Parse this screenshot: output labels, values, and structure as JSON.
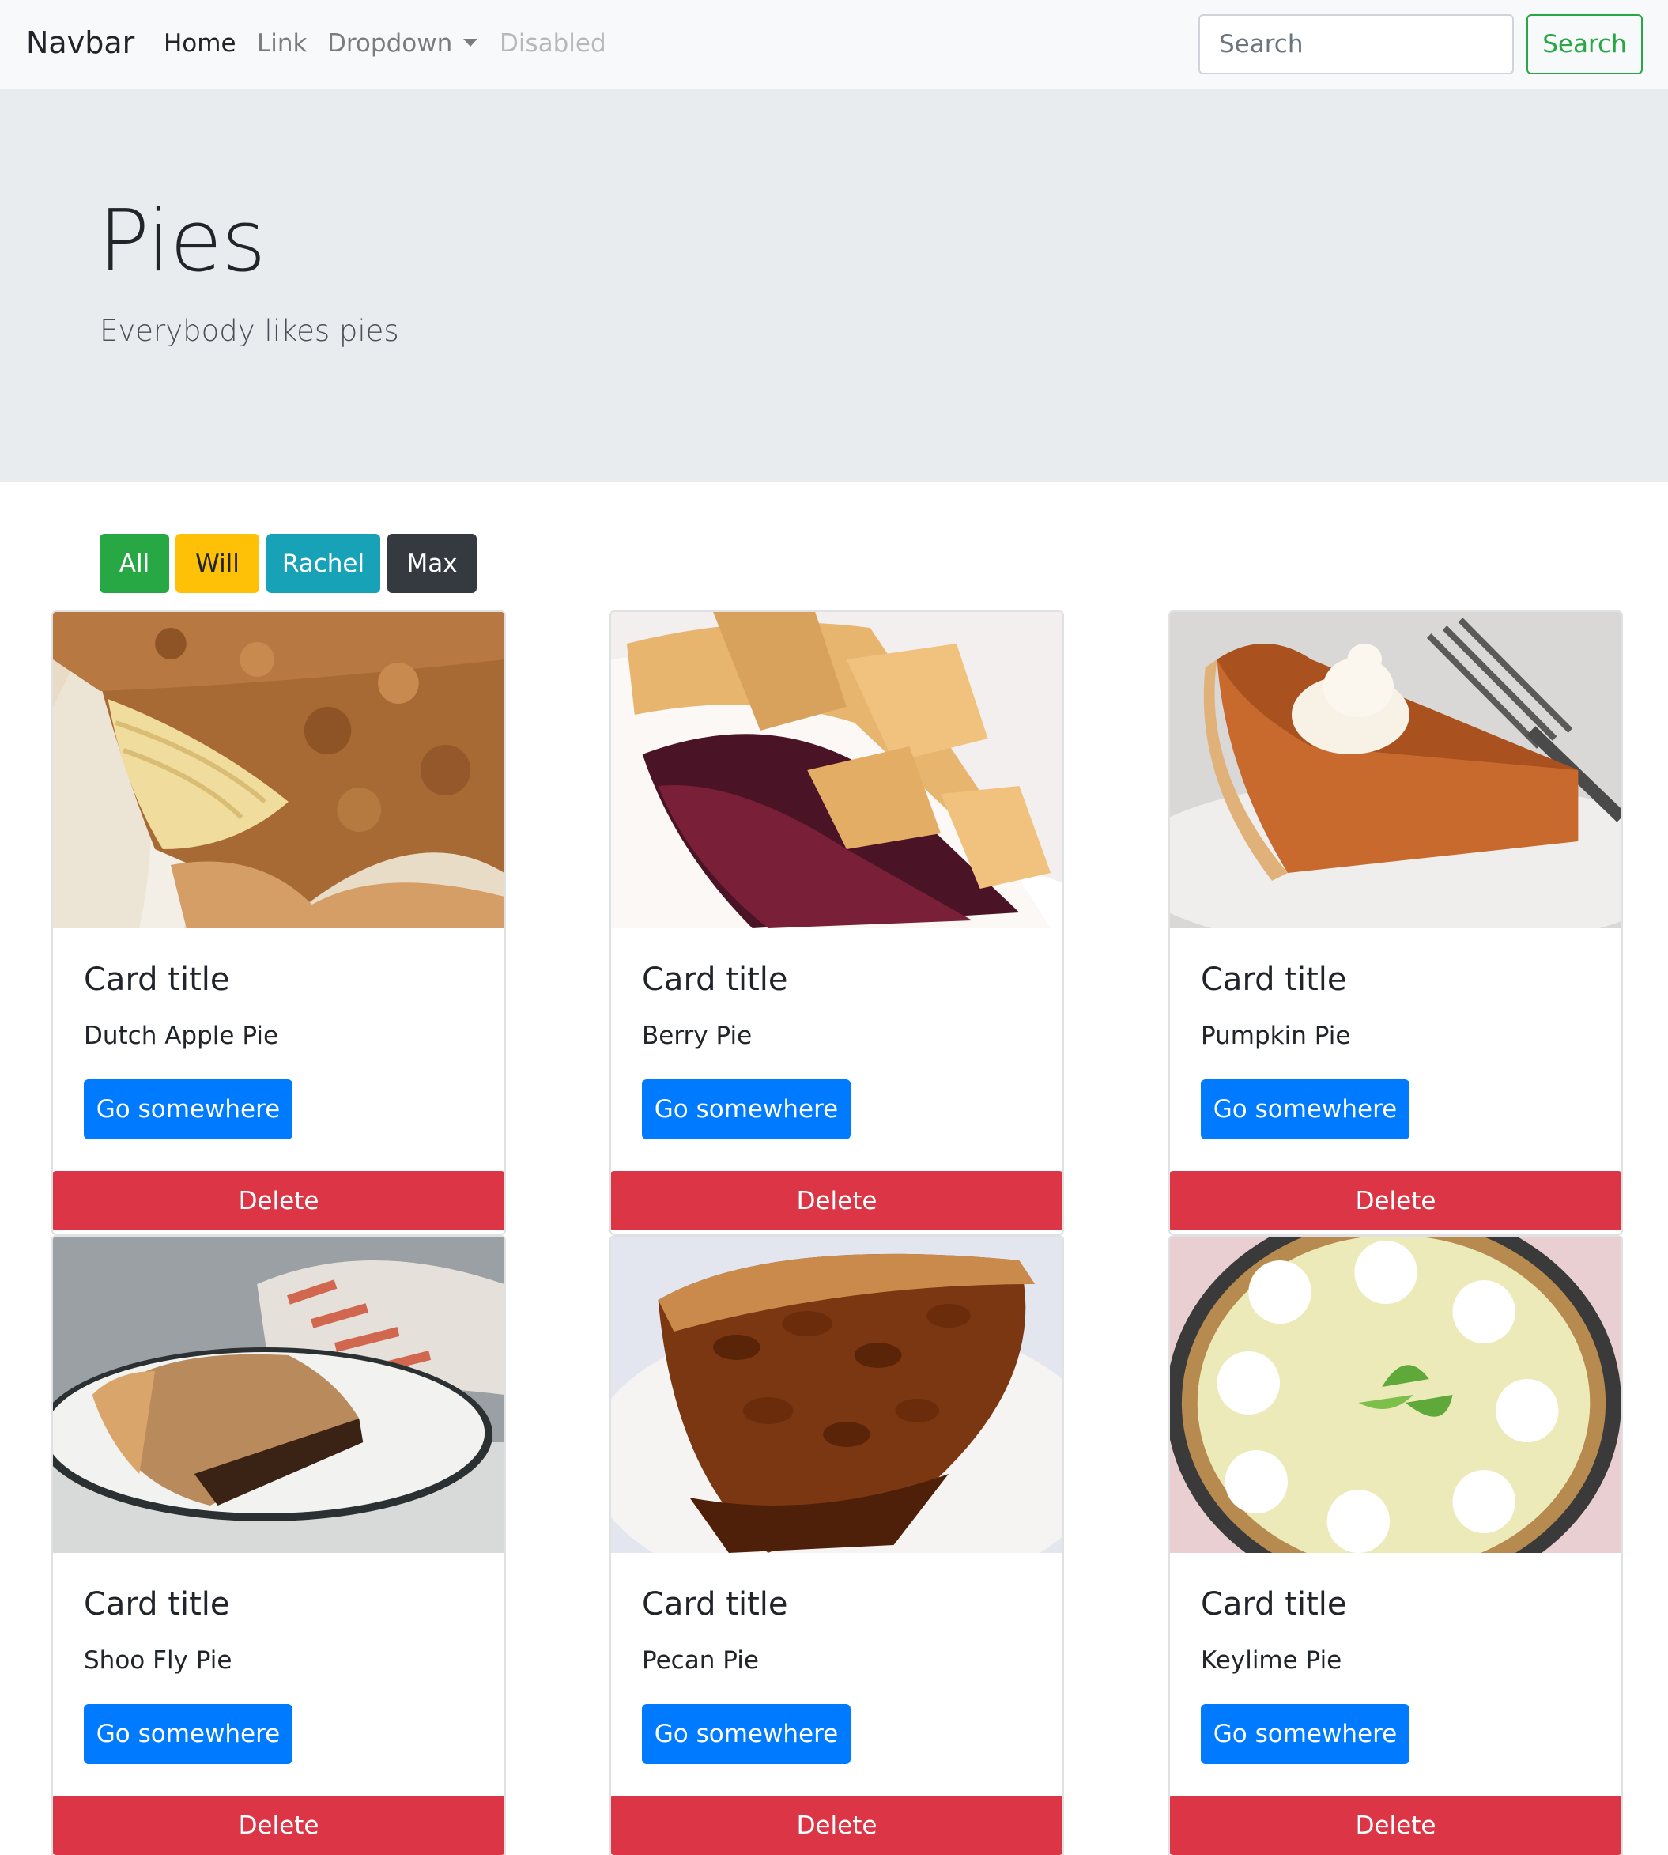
{
  "navbar": {
    "brand": "Navbar",
    "links": {
      "home": "Home",
      "link": "Link",
      "dropdown": "Dropdown",
      "disabled": "Disabled"
    },
    "search": {
      "placeholder": "Search",
      "button_label": "Search"
    }
  },
  "jumbotron": {
    "title": "Pies",
    "lead": "Everybody likes pies"
  },
  "filters": [
    {
      "label": "All",
      "color": "#28a745"
    },
    {
      "label": "Will",
      "color": "#ffc107"
    },
    {
      "label": "Rachel",
      "color": "#17a2b8"
    },
    {
      "label": "Max",
      "color": "#343a40"
    }
  ],
  "cards": [
    {
      "title": "Card title",
      "text": "Dutch Apple Pie",
      "button_label": "Go somewhere",
      "delete_label": "Delete",
      "image": "dutch-apple-pie-photo"
    },
    {
      "title": "Card title",
      "text": "Berry Pie",
      "button_label": "Go somewhere",
      "delete_label": "Delete",
      "image": "berry-pie-photo"
    },
    {
      "title": "Card title",
      "text": "Pumpkin Pie",
      "button_label": "Go somewhere",
      "delete_label": "Delete",
      "image": "pumpkin-pie-photo"
    },
    {
      "title": "Card title",
      "text": "Shoo Fly Pie",
      "button_label": "Go somewhere",
      "delete_label": "Delete",
      "image": "shoo-fly-pie-photo"
    },
    {
      "title": "Card title",
      "text": "Pecan Pie",
      "button_label": "Go somewhere",
      "delete_label": "Delete",
      "image": "pecan-pie-photo"
    },
    {
      "title": "Card title",
      "text": "Keylime Pie",
      "button_label": "Go somewhere",
      "delete_label": "Delete",
      "image": "keylime-pie-photo"
    }
  ],
  "colors": {
    "primary": "#007bff",
    "danger": "#dc3545",
    "success": "#28a745",
    "navbar_bg": "#f8f9fa",
    "jumbotron_bg": "#e9ecef"
  }
}
